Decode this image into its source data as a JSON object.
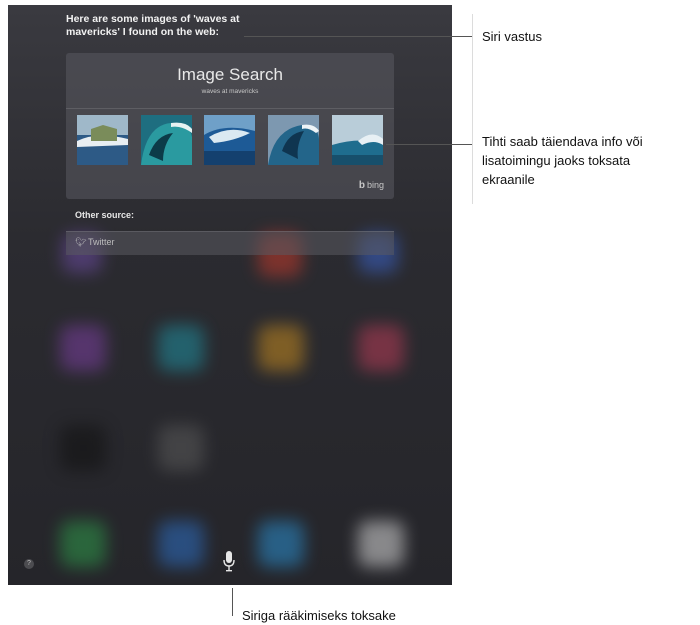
{
  "siri": {
    "response_line1": "Here are some images of 'waves at",
    "response_line2": "mavericks' I found on the web:"
  },
  "image_card": {
    "title": "Image Search",
    "query": "waves at mavericks",
    "provider": "bing"
  },
  "other_source": {
    "heading": "Other source:",
    "item": "Twitter"
  },
  "controls": {
    "help": "?"
  },
  "callouts": {
    "siri_response": "Siri vastus",
    "tap_info_1": "Tihti saab täiendava info või",
    "tap_info_2": "lisatoimingu jaoks toksata",
    "tap_info_3": "ekraanile",
    "mic": "Siriga rääkimiseks toksake"
  },
  "colors": {
    "screen_background": "#2b2b30",
    "card_background": "#5a5a60",
    "callout_text": "#111111"
  }
}
